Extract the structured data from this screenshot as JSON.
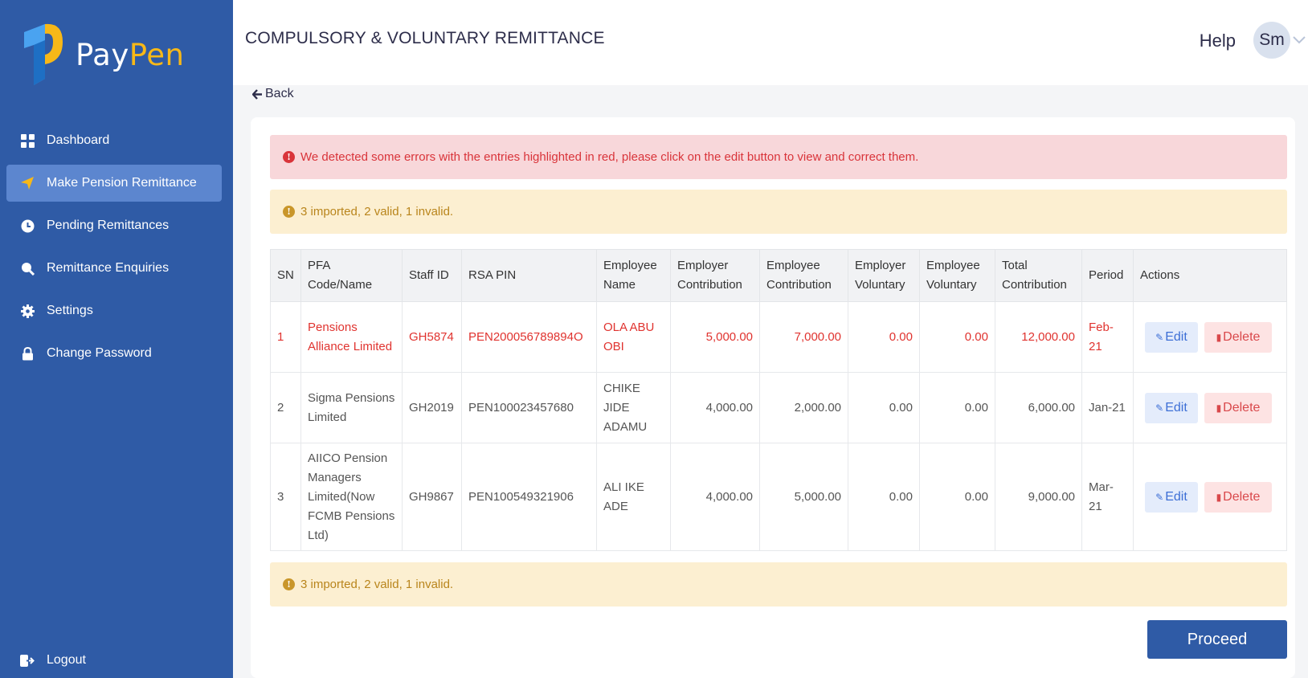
{
  "app": {
    "brand_part1": "Pay",
    "brand_part2": "Pen",
    "brand_accent_color": "#f7b818",
    "sidebar_color": "#2f5ba6"
  },
  "sidebar": {
    "items": [
      {
        "label": "Dashboard",
        "icon": "grid-icon"
      },
      {
        "label": "Make Pension Remittance",
        "icon": "send-icon",
        "active": true
      },
      {
        "label": "Pending Remittances",
        "icon": "clock-icon"
      },
      {
        "label": "Remittance Enquiries",
        "icon": "search-icon"
      },
      {
        "label": "Settings",
        "icon": "gear-icon"
      },
      {
        "label": "Change Password",
        "icon": "lock-icon"
      }
    ],
    "logout_label": "Logout"
  },
  "header": {
    "title": "COMPULSORY & VOLUNTARY REMITTANCE",
    "help": "Help",
    "avatar_initials": "Sm"
  },
  "back_label": "Back",
  "alerts": {
    "error": "We detected some errors with the entries highlighted in red, please click on the edit button to view and correct them.",
    "summary_top": "3 imported, 2 valid, 1 invalid.",
    "summary_bottom": "3 imported, 2 valid, 1 invalid."
  },
  "table": {
    "headers": [
      "SN",
      "PFA Code/Name",
      "Staff ID",
      "RSA PIN",
      "Employee Name",
      "Employer Contribution",
      "Employee Contribution",
      "Employer Voluntary",
      "Employee Voluntary",
      "Total Contribution",
      "Period",
      "Actions"
    ],
    "rows": [
      {
        "sn": "1",
        "pfa": "Pensions Alliance Limited",
        "staff_id": "GH5874",
        "rsa_pin": "PEN200056789894O",
        "name": "OLA ABU OBI",
        "employer_contribution": "5,000.00",
        "employee_contribution": "7,000.00",
        "employer_voluntary": "0.00",
        "employee_voluntary": "0.00",
        "total": "12,000.00",
        "period": "Feb-21",
        "error": true
      },
      {
        "sn": "2",
        "pfa": "Sigma Pensions Limited",
        "staff_id": "GH2019",
        "rsa_pin": "PEN100023457680",
        "name": "CHIKE JIDE ADAMU",
        "employer_contribution": "4,000.00",
        "employee_contribution": "2,000.00",
        "employer_voluntary": "0.00",
        "employee_voluntary": "0.00",
        "total": "6,000.00",
        "period": "Jan-21",
        "error": false
      },
      {
        "sn": "3",
        "pfa": "AIICO Pension Managers Limited(Now FCMB Pensions Ltd)",
        "staff_id": "GH9867",
        "rsa_pin": "PEN100549321906",
        "name": "ALI IKE ADE",
        "employer_contribution": "4,000.00",
        "employee_contribution": "5,000.00",
        "employer_voluntary": "0.00",
        "employee_voluntary": "0.00",
        "total": "9,000.00",
        "period": "Mar-21",
        "error": false
      }
    ],
    "edit_label": "Edit",
    "delete_label": "Delete"
  },
  "proceed_label": "Proceed"
}
